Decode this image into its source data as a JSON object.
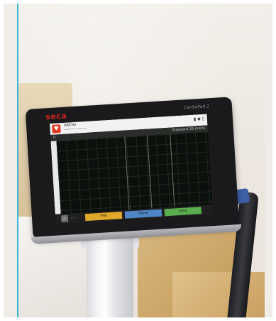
{
  "device": {
    "brand": "seca",
    "model": "CardioPad 2"
  },
  "screen": {
    "patient_name": "ABCDe",
    "patient_sub": "——— ———",
    "status_icons": "▮ ◆ ▯",
    "subheader_left": "II",
    "subheader_right": "Standard 25 mm/s",
    "heart_symbol": "♥",
    "buttons": {
      "left": "Stop",
      "middle": "Pause",
      "right": "Save"
    },
    "home_symbol": "⌂",
    "nav_symbol": "‹ ›"
  },
  "colors": {
    "brand_red": "#d0221c",
    "orange_button": "#e1a92c",
    "blue_button": "#4f86c6",
    "green_button": "#5aad4e",
    "frame_accent": "#39b5d6"
  }
}
